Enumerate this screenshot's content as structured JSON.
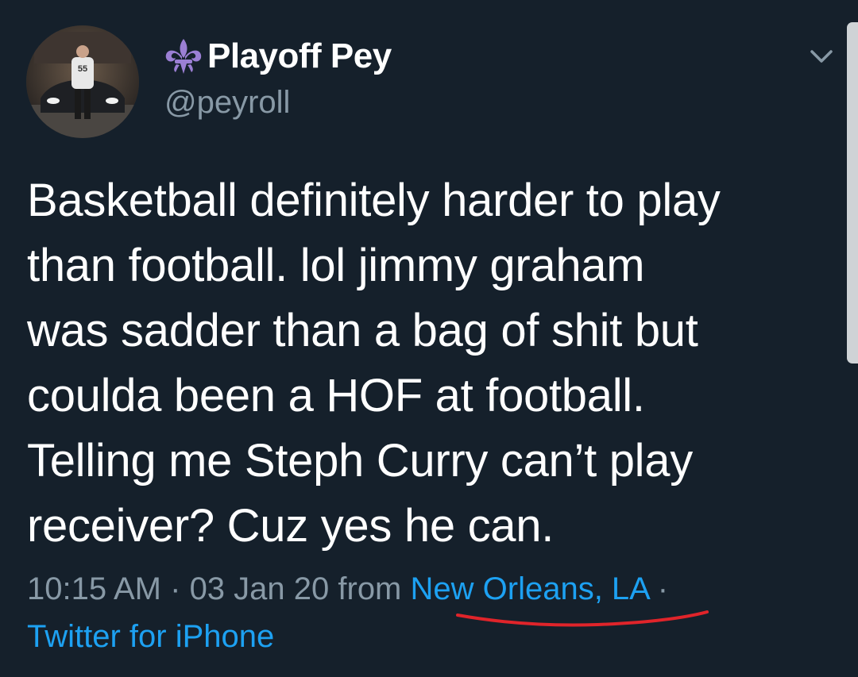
{
  "author": {
    "display_name": "Playoff Pey",
    "handle": "@peyroll",
    "name_icon": "fleur-de-lis-icon",
    "avatar_jersey_number": "55"
  },
  "tweet": {
    "text_lines": [
      "Basketball definitely harder to play",
      "than football. lol jimmy graham",
      "was sadder than a bag of shit but",
      "coulda been a HOF at football.",
      "Telling me Steph Curry can’t play",
      "receiver? Cuz yes he can."
    ]
  },
  "meta": {
    "time": "10:15 AM",
    "separator": " · ",
    "date": "03 Jan 20",
    "from_label": " from ",
    "location": "New Orleans, LA",
    "trailing_separator": " ·",
    "source": "Twitter for iPhone"
  },
  "colors": {
    "background": "#15202b",
    "text": "#ffffff",
    "secondary_text": "#8899a6",
    "link": "#1da1f2",
    "fleur": "#9b7fd4",
    "annotation": "#e0242a"
  }
}
